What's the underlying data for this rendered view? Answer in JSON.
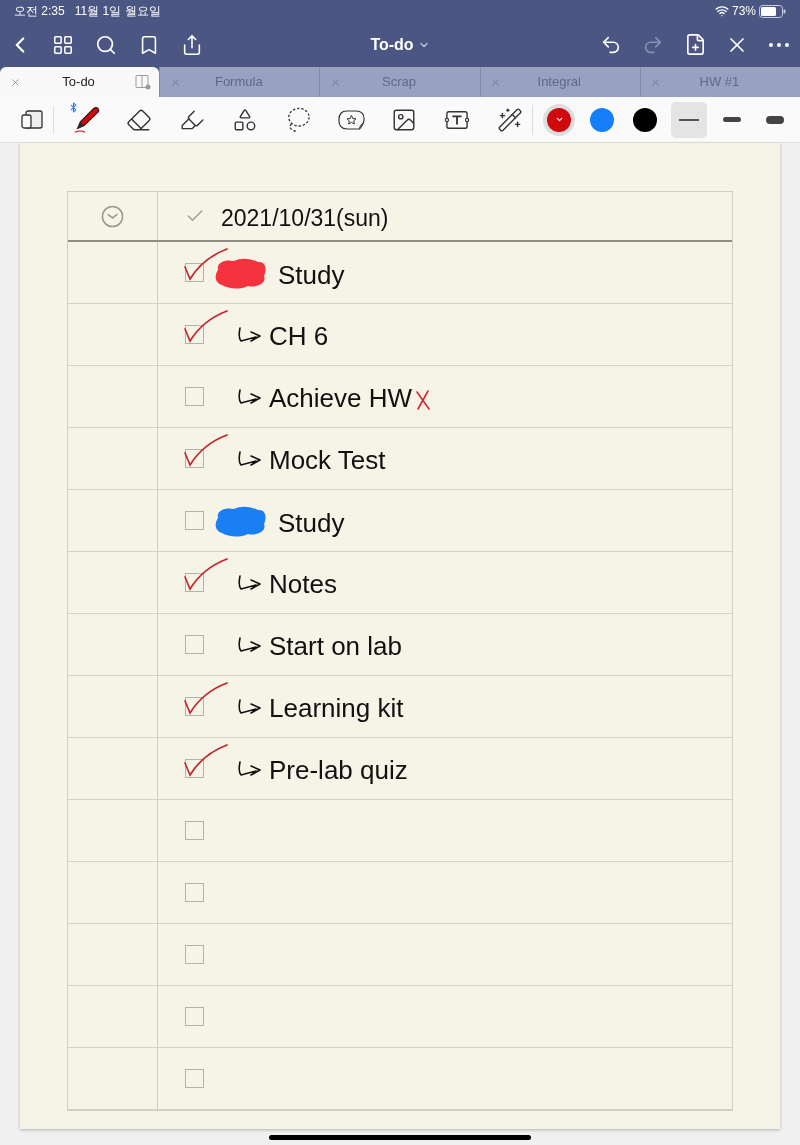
{
  "status_bar": {
    "time": "오전 2:35",
    "date": "11월 1일 월요일",
    "battery": "73%"
  },
  "navigation_bar": {
    "title": "To-do",
    "redo": {
      "disabled": true
    }
  },
  "tabs": [
    {
      "label": "To-do",
      "selected": true
    },
    {
      "label": "Formula",
      "selected": false
    },
    {
      "label": "Scrap",
      "selected": false
    },
    {
      "label": "Integral",
      "selected": false
    },
    {
      "label": "HW #1",
      "selected": false
    }
  ],
  "tools": [
    {
      "kind": "pen",
      "selected": true
    },
    {
      "kind": "eraser",
      "selected": false
    },
    {
      "kind": "highlighter",
      "selected": false
    },
    {
      "kind": "shapes",
      "selected": false
    },
    {
      "kind": "lasso",
      "selected": false
    },
    {
      "kind": "sticker",
      "selected": false
    },
    {
      "kind": "image",
      "selected": false
    },
    {
      "kind": "text",
      "selected": false
    },
    {
      "kind": "laser",
      "selected": false
    }
  ],
  "colors": [
    {
      "color": "#d0090f",
      "selected": true
    },
    {
      "color": "#147efb",
      "selected": false
    },
    {
      "color": "#000000",
      "selected": false
    }
  ],
  "stroke_widths": [
    {
      "kind": "thin",
      "selected": true
    },
    {
      "kind": "medium",
      "selected": false
    },
    {
      "kind": "thick",
      "selected": false
    }
  ],
  "todo": {
    "date": "2021/10/31(sun)",
    "tasks": [
      {
        "text": "Study",
        "checked": true,
        "color": "#f4333f",
        "children": [
          {
            "text": "CH 6",
            "checked": true
          },
          {
            "text": "Achieve HW",
            "checked": false,
            "x_mark": true
          },
          {
            "text": "Mock Test",
            "checked": true
          }
        ]
      },
      {
        "text": "Study",
        "checked": false,
        "color": "#1a7ff2",
        "children": [
          {
            "text": "Notes",
            "checked": true
          },
          {
            "text": "Start on lab",
            "checked": false
          },
          {
            "text": "Learning kit",
            "checked": true
          },
          {
            "text": "Pre-lab quiz",
            "checked": true
          }
        ]
      }
    ],
    "blank_rows": [
      {
        "checked": false
      },
      {
        "checked": false
      },
      {
        "checked": false
      },
      {
        "checked": false
      },
      {
        "checked": false
      }
    ]
  }
}
